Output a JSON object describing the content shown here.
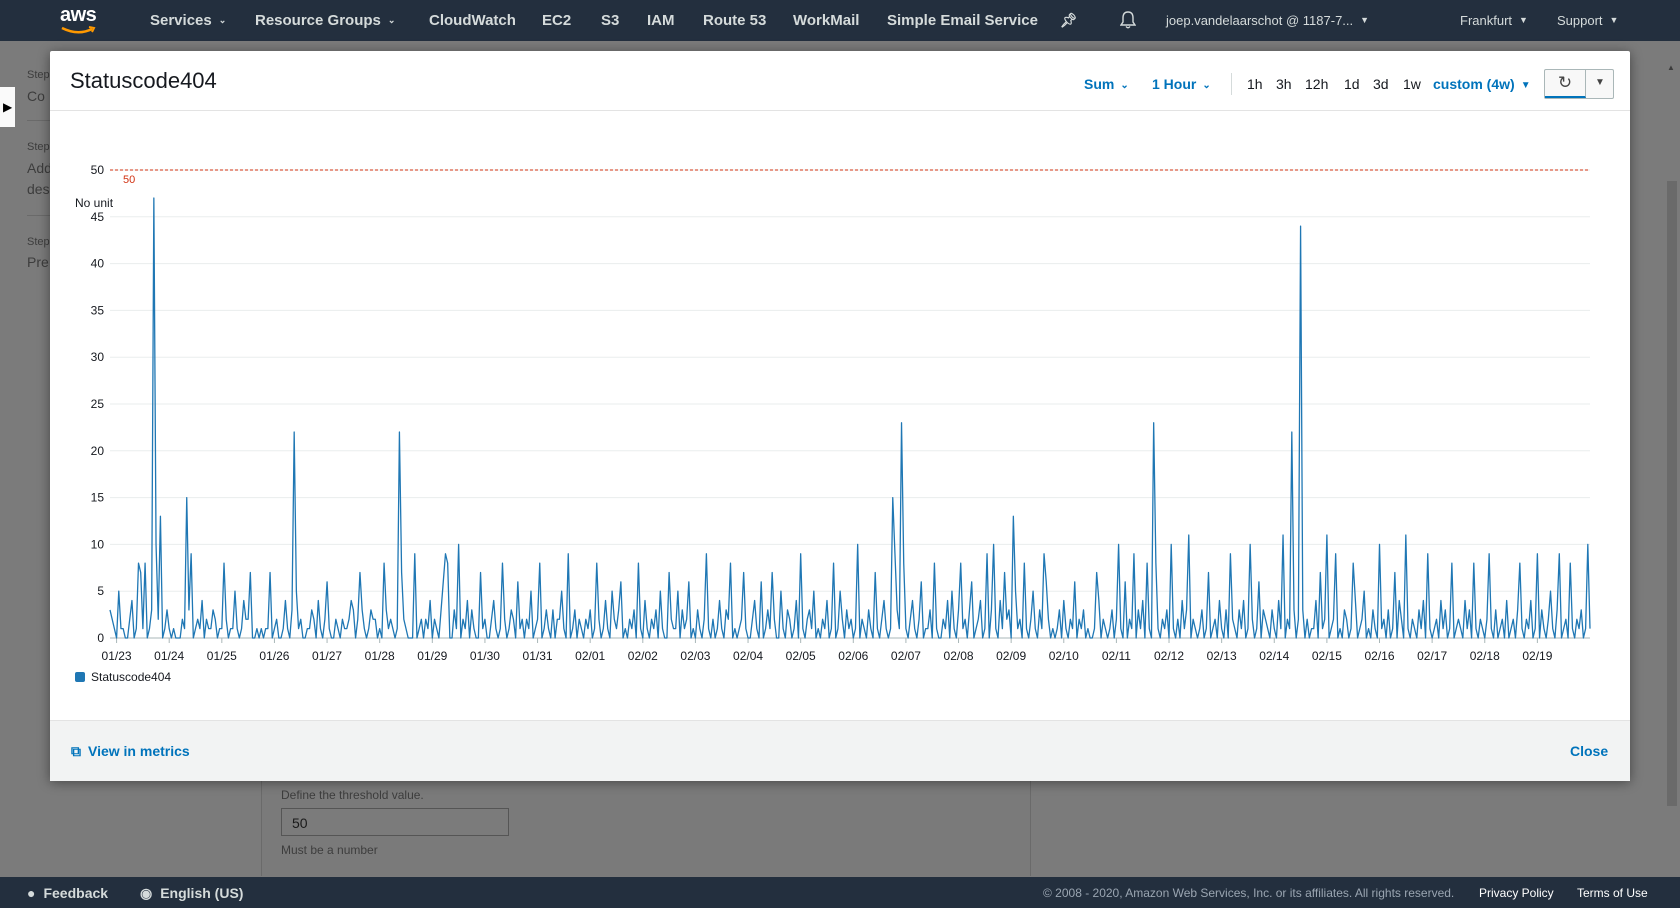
{
  "nav": {
    "logo": "aws",
    "items": [
      "Services",
      "Resource Groups",
      "CloudWatch",
      "EC2",
      "S3",
      "IAM",
      "Route 53",
      "WorkMail",
      "Simple Email Service"
    ],
    "account": "joep.vandelaarschot @ 1187-7...",
    "region": "Frankfurt",
    "support": "Support"
  },
  "background": {
    "steps": [
      "Step",
      "Co",
      "Step",
      "Add",
      "des",
      "Step",
      "Pre"
    ],
    "threshold_heading": "Define the threshold value.",
    "threshold_value": "50",
    "threshold_hint": "Must be a number"
  },
  "footer": {
    "feedback": "Feedback",
    "language": "English (US)",
    "copyright": "© 2008 - 2020, Amazon Web Services, Inc. or its affiliates. All rights reserved.",
    "privacy": "Privacy Policy",
    "terms": "Terms of Use"
  },
  "modal": {
    "title": "Statuscode404",
    "statistic": "Sum",
    "period": "1 Hour",
    "ranges": [
      "1h",
      "3h",
      "12h",
      "1d",
      "3d",
      "1w"
    ],
    "custom_range": "custom (4w)",
    "view_in_metrics": "View in metrics",
    "close": "Close"
  },
  "colors": {
    "nav_bg": "#232f3e",
    "series": "#1f77b4",
    "threshold": "#d13212",
    "link": "#0073bb"
  },
  "chart_data": {
    "type": "line",
    "ylabel": "No unit",
    "ylim": [
      0,
      50
    ],
    "yticks": [
      0,
      5,
      10,
      15,
      20,
      25,
      30,
      35,
      40,
      45,
      50
    ],
    "xticks": [
      "01/23",
      "01/24",
      "01/25",
      "01/26",
      "01/27",
      "01/28",
      "01/29",
      "01/30",
      "01/31",
      "02/01",
      "02/02",
      "02/03",
      "02/04",
      "02/05",
      "02/06",
      "02/07",
      "02/08",
      "02/09",
      "02/10",
      "02/11",
      "02/12",
      "02/13",
      "02/14",
      "02/15",
      "02/16",
      "02/17",
      "02/18",
      "02/19"
    ],
    "threshold": {
      "value": 50,
      "label": "50"
    },
    "grid": true,
    "legend": "bottom-left",
    "series": [
      {
        "name": "Statuscode404",
        "x_start": "01/22 21:00",
        "interval_hours": 1,
        "values": [
          3,
          2,
          1,
          0,
          5,
          1,
          1,
          0,
          0,
          2,
          4,
          0,
          1,
          8,
          7,
          1,
          8,
          0,
          1,
          3,
          47,
          10,
          2,
          13,
          0,
          1,
          3,
          1,
          0,
          1,
          0,
          0,
          0,
          2,
          1,
          15,
          3,
          9,
          0,
          1,
          2,
          1,
          4,
          0,
          2,
          1,
          1,
          3,
          2,
          0,
          1,
          1,
          8,
          2,
          0,
          1,
          1,
          5,
          1,
          0,
          1,
          4,
          2,
          2,
          7,
          0,
          0,
          1,
          0,
          1,
          0,
          1,
          1,
          7,
          0,
          1,
          2,
          0,
          0,
          1,
          4,
          1,
          0,
          3,
          22,
          5,
          1,
          2,
          0,
          0,
          1,
          1,
          3,
          2,
          0,
          4,
          1,
          0,
          2,
          6,
          1,
          0,
          0,
          2,
          1,
          0,
          2,
          1,
          1,
          2,
          4,
          3,
          0,
          2,
          7,
          3,
          1,
          0,
          1,
          3,
          2,
          2,
          0,
          1,
          0,
          8,
          3,
          1,
          2,
          1,
          0,
          1,
          22,
          7,
          2,
          1,
          0,
          0,
          0,
          9,
          0,
          1,
          2,
          0,
          2,
          1,
          4,
          0,
          2,
          1,
          0,
          3,
          6,
          9,
          8,
          0,
          0,
          3,
          1,
          10,
          0,
          2,
          1,
          4,
          0,
          3,
          1,
          0,
          0,
          7,
          1,
          2,
          0,
          0,
          2,
          4,
          1,
          0,
          1,
          8,
          2,
          0,
          1,
          3,
          2,
          0,
          6,
          1,
          2,
          0,
          2,
          1,
          5,
          0,
          1,
          2,
          8,
          0,
          1,
          3,
          1,
          0,
          3,
          0,
          2,
          2,
          5,
          1,
          0,
          9,
          0,
          1,
          3,
          0,
          2,
          1,
          0,
          2,
          1,
          3,
          0,
          1,
          8,
          2,
          0,
          1,
          4,
          1,
          0,
          5,
          2,
          1,
          3,
          6,
          0,
          1,
          0,
          2,
          1,
          3,
          0,
          8,
          1,
          0,
          4,
          1,
          0,
          2,
          1,
          3,
          0,
          5,
          1,
          0,
          0,
          7,
          2,
          1,
          1,
          5,
          0,
          3,
          1,
          2,
          6,
          0,
          1,
          0,
          3,
          1,
          0,
          2,
          9,
          1,
          0,
          2,
          0,
          1,
          4,
          1,
          0,
          3,
          2,
          8,
          0,
          1,
          0,
          1,
          2,
          7,
          1,
          0,
          0,
          2,
          4,
          1,
          0,
          6,
          0,
          1,
          3,
          1,
          7,
          2,
          0,
          0,
          5,
          1,
          0,
          3,
          2,
          0,
          1,
          4,
          0,
          9,
          1,
          0,
          2,
          3,
          1,
          5,
          0,
          1,
          0,
          2,
          1,
          4,
          0,
          1,
          8,
          0,
          1,
          5,
          2,
          0,
          3,
          1,
          2,
          0,
          1,
          10,
          0,
          2,
          1,
          0,
          3,
          1,
          0,
          7,
          1,
          0,
          2,
          4,
          1,
          0,
          1,
          15,
          9,
          3,
          1,
          23,
          8,
          1,
          0,
          2,
          4,
          1,
          0,
          2,
          6,
          0,
          1,
          1,
          3,
          0,
          8,
          1,
          0,
          0,
          2,
          1,
          4,
          0,
          5,
          1,
          0,
          3,
          8,
          1,
          2,
          0,
          3,
          6,
          0,
          1,
          2,
          4,
          0,
          1,
          9,
          0,
          3,
          10,
          1,
          0,
          4,
          1,
          7,
          2,
          3,
          0,
          13,
          5,
          1,
          2,
          0,
          8,
          1,
          0,
          2,
          5,
          1,
          0,
          3,
          1,
          9,
          6,
          2,
          0,
          1,
          0,
          1,
          3,
          0,
          4,
          1,
          0,
          2,
          1,
          6,
          0,
          2,
          1,
          3,
          0,
          1,
          0,
          0,
          1,
          7,
          4,
          0,
          2,
          1,
          0,
          1,
          3,
          0,
          2,
          10,
          1,
          0,
          6,
          0,
          2,
          1,
          9,
          0,
          3,
          1,
          4,
          0,
          8,
          1,
          0,
          23,
          8,
          1,
          0,
          2,
          1,
          3,
          0,
          10,
          1,
          0,
          2,
          0,
          4,
          1,
          3,
          11,
          0,
          2,
          1,
          0,
          1,
          3,
          0,
          1,
          7,
          0,
          1,
          2,
          0,
          4,
          1,
          0,
          3,
          0,
          9,
          2,
          1,
          0,
          3,
          1,
          4,
          0,
          1,
          10,
          2,
          0,
          1,
          6,
          0,
          3,
          2,
          1,
          0,
          3,
          1,
          0,
          4,
          1,
          11,
          0,
          2,
          1,
          22,
          3,
          0,
          2,
          44,
          3,
          0,
          2,
          0,
          1,
          1,
          4,
          0,
          7,
          1,
          2,
          11,
          0,
          1,
          2,
          9,
          0,
          1,
          0,
          3,
          2,
          0,
          1,
          8,
          4,
          0,
          1,
          2,
          5,
          0,
          1,
          0,
          3,
          1,
          0,
          10,
          1,
          2,
          0,
          3,
          0,
          1,
          7,
          0,
          4,
          2,
          0,
          11,
          1,
          0,
          2,
          1,
          0,
          3,
          1,
          4,
          0,
          9,
          1,
          0,
          1,
          2,
          0,
          4,
          1,
          3,
          0,
          1,
          8,
          0,
          1,
          2,
          1,
          0,
          4,
          1,
          3,
          0,
          8,
          1,
          0,
          2,
          1,
          0,
          2,
          9,
          1,
          0,
          3,
          0,
          1,
          2,
          0,
          4,
          0,
          1,
          2,
          0,
          3,
          8,
          1,
          0,
          2,
          1,
          4,
          0,
          1,
          9,
          0,
          3,
          1,
          0,
          2,
          5,
          1,
          0,
          3,
          9,
          0,
          1,
          2,
          0,
          8,
          1,
          0,
          2,
          1,
          3,
          0,
          1,
          10,
          1
        ]
      }
    ]
  }
}
